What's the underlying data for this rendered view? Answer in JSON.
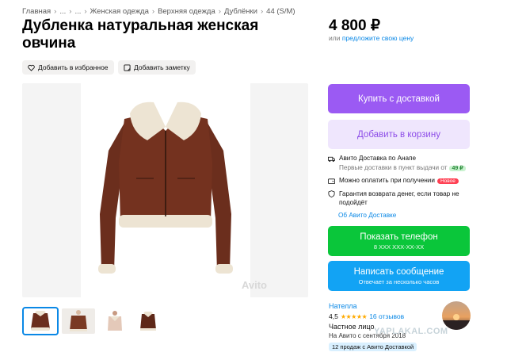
{
  "breadcrumb": [
    "Главная",
    "...",
    "...",
    "Женская одежда",
    "Верхняя одежда",
    "Дублёнки",
    "44 (S/M)"
  ],
  "title": "Дубленка натуральная женская овчина",
  "price": {
    "value": "4 800 ₽",
    "or_text": "или",
    "offer_link": "предложите свою цену"
  },
  "actions": {
    "favorite": "Добавить в избранное",
    "note": "Добавить заметку"
  },
  "gallery": {
    "watermark": "Avito",
    "thumbnail_count": 4
  },
  "buttons": {
    "buy": "Купить с доставкой",
    "cart": "Добавить в корзину",
    "phone": "Показать телефон",
    "phone_number": "8 XXX XXX-XX-XX",
    "message": "Написать сообщение",
    "message_sub": "Отвечает за несколько часов"
  },
  "delivery": {
    "title": "Авито Доставка по Анапе",
    "sub": "Первые доставки в пункт выдачи от",
    "price_badge": "49 ₽",
    "pay_on_receipt": "Можно оплатить при получении",
    "new_badge": "Новое",
    "guarantee": "Гарантия возврата денег, если товар не подойдёт",
    "about_link": "Об Авито Доставке"
  },
  "seller": {
    "name": "Нателла",
    "rating": "4,5",
    "stars": "★★★★★",
    "reviews": "16 отзывов",
    "type": "Частное лицо",
    "since": "На Авито с сентября 2018",
    "sales": "12 продаж с Авито Доставкой"
  },
  "site_watermark": "YAPLAKAL.COM",
  "colors": {
    "buy": "#9b5af3",
    "cart_bg": "#efe6fd",
    "phone": "#0ac63a",
    "message": "#12a3f4",
    "link": "#0a88e6",
    "jacket": "#6b2e1d",
    "fur": "#ede4d3"
  }
}
